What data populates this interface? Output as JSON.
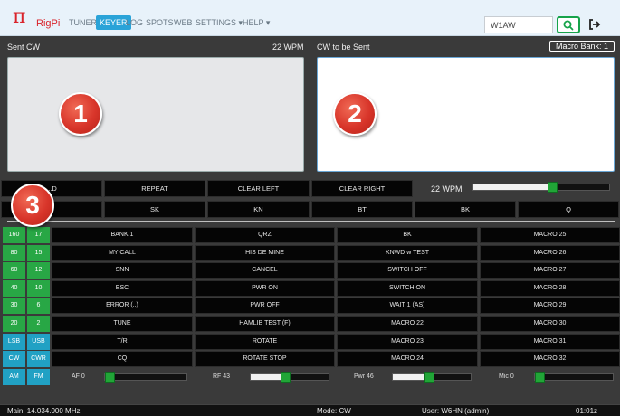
{
  "navbar": {
    "brand": "RigPi",
    "items": [
      "TUNER",
      "KEYER",
      "LOG",
      "SPOTS",
      "WEB",
      "SETTINGS ▾",
      "HELP ▾"
    ],
    "callsign_value": "W1AW"
  },
  "panels": {
    "sent_label": "Sent CW",
    "sent_wpm": "22 WPM",
    "to_send_label": "CW to be Sent",
    "macro_bank": "Macro Bank: 1"
  },
  "badges": [
    "1",
    "2",
    "3"
  ],
  "keyer": {
    "row1": [
      "...D",
      "REPEAT",
      "CLEAR LEFT",
      "CLEAR RIGHT"
    ],
    "row2": [
      "",
      "SK",
      "KN",
      "BT",
      "BK",
      "Q"
    ],
    "wpm_label": "22  WPM",
    "wpm_level_percent": 58
  },
  "bands": [
    [
      "160",
      "17"
    ],
    [
      "80",
      "15"
    ],
    [
      "60",
      "12"
    ],
    [
      "40",
      "10"
    ],
    [
      "30",
      "6"
    ],
    [
      "20",
      "2"
    ],
    [
      "LSB",
      "USB"
    ],
    [
      "CW",
      "CWR"
    ],
    [
      "AM",
      "FM"
    ]
  ],
  "macros": [
    [
      "BANK 1",
      "QRZ",
      "BK",
      "MACRO 25"
    ],
    [
      "MY CALL",
      "HIS DE MINE",
      "KNWD w TEST",
      "MACRO 26"
    ],
    [
      "SNN",
      "CANCEL",
      "SWITCH OFF",
      "MACRO 27"
    ],
    [
      "ESC",
      "PWR ON",
      "SWITCH ON",
      "MACRO 28"
    ],
    [
      "ERROR (..)",
      "PWR OFF",
      "WAIT 1 (AS)",
      "MACRO 29"
    ],
    [
      "TUNE",
      "HAMLIB TEST (F)",
      "MACRO 22",
      "MACRO 30"
    ],
    [
      "T/R",
      "ROTATE",
      "MACRO 23",
      "MACRO 31"
    ],
    [
      "CQ",
      "ROTATE STOP",
      "MACRO 24",
      "MACRO 32"
    ]
  ],
  "controls": [
    {
      "label": "AF  0",
      "level_percent": 0
    },
    {
      "label": "RF  43",
      "level_percent": 43
    },
    {
      "label": "Pwr  46",
      "level_percent": 46
    },
    {
      "label": "Mic  0",
      "level_percent": 0
    }
  ],
  "status": {
    "main": "Main: 14.034.000 MHz",
    "mode": "Mode: CW",
    "user": "User: W6HN (admin)",
    "time": "01:01z"
  },
  "icons": {
    "logo": "pi-logo-icon",
    "search": "search-icon",
    "logout": "logout-icon"
  },
  "colors": {
    "brand_red": "#d9242b",
    "active_tab": "#2aa3d8",
    "band_green": "#28a745",
    "mode_teal": "#21a1c4",
    "slider_thumb": "#21a537"
  }
}
